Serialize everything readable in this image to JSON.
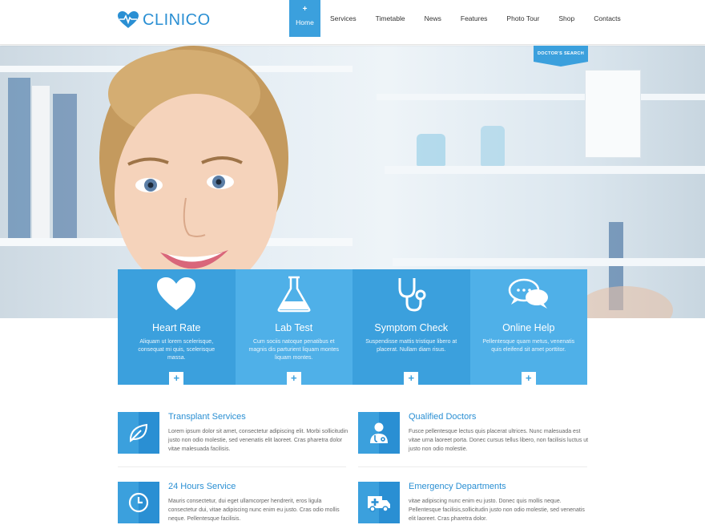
{
  "brand": {
    "name": "CLINICO",
    "accent": "#3ba0dd",
    "accent_dark": "#2a8fd3"
  },
  "nav": {
    "items": [
      {
        "label": "Home",
        "active": true
      },
      {
        "label": "Services"
      },
      {
        "label": "Timetable"
      },
      {
        "label": "News"
      },
      {
        "label": "Features"
      },
      {
        "label": "Photo Tour"
      },
      {
        "label": "Shop"
      },
      {
        "label": "Contacts"
      }
    ],
    "home_plus": "+"
  },
  "hero": {
    "doctor_search_label": "DOCTOR'S SEARCH"
  },
  "features": [
    {
      "icon": "heart-icon",
      "title": "Heart Rate",
      "desc": "Aliquam ut lorem scelerisque, consequat mi quis, scelerisque massa.",
      "color": "#3ba0dd",
      "plus": "+"
    },
    {
      "icon": "flask-icon",
      "title": "Lab Test",
      "desc": "Cum sociis natoque penatibus et magnis dis parturient liquam montes liquam montes.",
      "color": "#4fb0e8",
      "plus": "+"
    },
    {
      "icon": "stethoscope-icon",
      "title": "Symptom Check",
      "desc": "Suspendisse mattis tristique libero at placerat. Nullam diam risus.",
      "color": "#3ba0dd",
      "plus": "+"
    },
    {
      "icon": "chat-icon",
      "title": "Online Help",
      "desc": "Pellentesque quam metus, venenatis quis eleifend sit amet porttitor.",
      "color": "#4fb0e8",
      "plus": "+"
    }
  ],
  "services": [
    {
      "icon": "leaf-icon",
      "title": "Transplant Services",
      "desc": "Lorem ipsum dolor sit amet, consectetur adipiscing elit. Morbi sollicitudin justo non odio molestie, sed venenatis elit laoreet. Cras pharetra dolor vitae malesuada facilisis."
    },
    {
      "icon": "doctor-icon",
      "title": "Qualified Doctors",
      "desc": "Fusce pellentesque lectus quis placerat ultrices. Nunc malesuada est vitae urna laoreet porta. Donec cursus tellus libero, non facilisis luctus ut justo non odio molestie."
    },
    {
      "icon": "clock-icon",
      "title": "24 Hours Service",
      "desc": "Mauris consectetur, dui eget ullamcorper hendrerit, eros ligula consectetur dui, vitae adipiscing nunc enim eu justo. Cras odio mollis neque. Pellentesque facilisis."
    },
    {
      "icon": "ambulance-icon",
      "title": "Emergency Departments",
      "desc": "vitae adipiscing nunc enim eu justo. Donec quis mollis neque. Pellentesque facilisis,sollicitudin justo non odio molestie, sed venenatis elit laoreet. Cras pharetra dolor."
    }
  ]
}
